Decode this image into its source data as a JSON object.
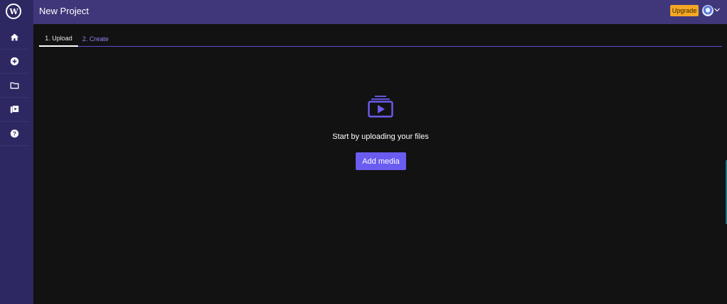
{
  "app": {
    "logo_letter": "W",
    "project_title": "New Project"
  },
  "header": {
    "upgrade_label": "Upgrade",
    "avatar_icon": "user-avatar",
    "chevron_icon": "chevron-down-icon"
  },
  "sidebar": {
    "items": [
      {
        "icon": "home-icon"
      },
      {
        "icon": "add-circle-icon"
      },
      {
        "icon": "folder-icon"
      },
      {
        "icon": "media-library-icon"
      },
      {
        "icon": "help-icon"
      }
    ]
  },
  "tabs": [
    {
      "label": "1. Upload",
      "active": true
    },
    {
      "label": "2. Create",
      "active": false
    }
  ],
  "main": {
    "icon": "upload-media-icon",
    "prompt": "Start by uploading your files",
    "add_media_label": "Add media"
  },
  "colors": {
    "sidebar_bg": "#2e2862",
    "topbar_bg": "#3f3779",
    "canvas_bg": "#121212",
    "accent": "#6a5cf0",
    "upgrade": "#f5a623"
  }
}
